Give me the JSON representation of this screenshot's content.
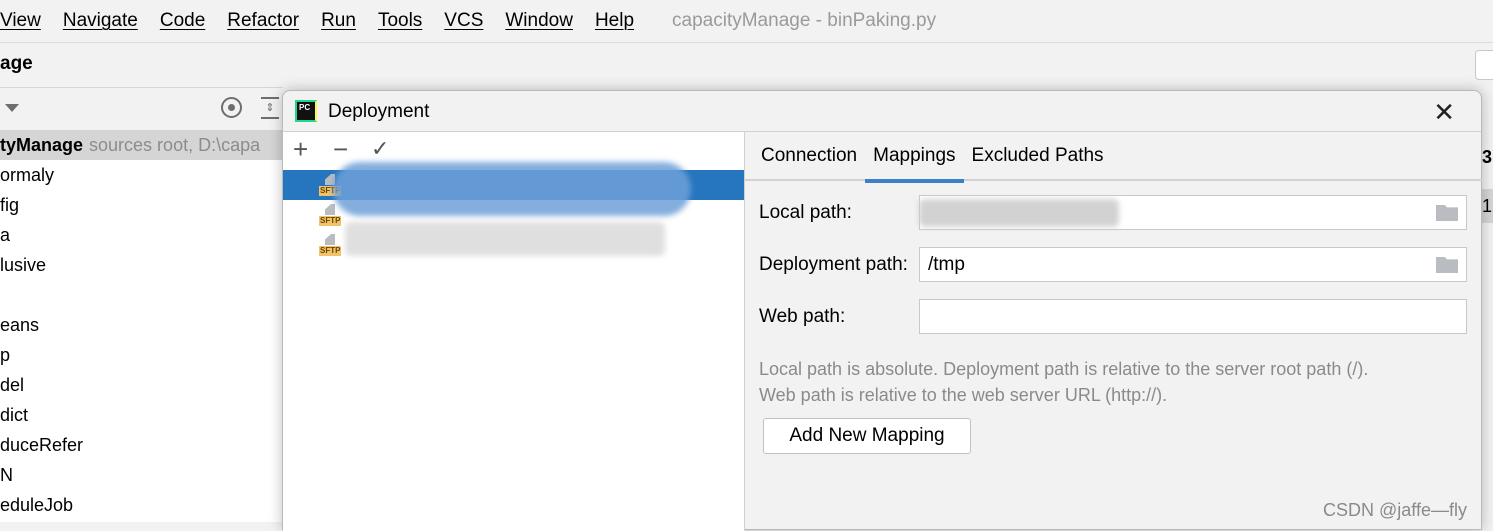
{
  "menubar": {
    "items": [
      "View",
      "Navigate",
      "Code",
      "Refactor",
      "Run",
      "Tools",
      "VCS",
      "Window",
      "Help"
    ],
    "title": "capacityManage - binPaking.py"
  },
  "project": {
    "name": "age"
  },
  "tree": {
    "root_name": "tyManage",
    "root_hint": "sources root,  D:\\capa",
    "items": [
      "ormaly",
      "fig",
      "a",
      "lusive",
      "",
      "eans",
      "p",
      "del",
      "dict",
      "duceRefer",
      "N",
      "eduleJob"
    ]
  },
  "right_strip": {
    "t1": "3:",
    "t2": "1"
  },
  "dialog": {
    "title": "Deployment",
    "close_icon": "close-icon",
    "toolbar": {
      "add": "+",
      "remove": "−",
      "check": "✓"
    },
    "servers": [
      {
        "type": "SFTP",
        "selected": true
      },
      {
        "type": "SFTP",
        "selected": false
      },
      {
        "type": "SFTP",
        "selected": false
      }
    ],
    "tabs": [
      "Connection",
      "Mappings",
      "Excluded Paths"
    ],
    "active_tab": "Mappings",
    "fields": {
      "local_label": "Local path:",
      "local_value": "",
      "deploy_label": "Deployment path:",
      "deploy_value": "/tmp",
      "web_label": "Web path:",
      "web_value": ""
    },
    "help1": "Local path is absolute. Deployment path is relative to the server root path (/).",
    "help2": "Web path is relative to the web server URL (http://).",
    "add_button": "Add New Mapping",
    "accent": "#2675bf"
  },
  "watermark": "CSDN @jaffe—fly"
}
